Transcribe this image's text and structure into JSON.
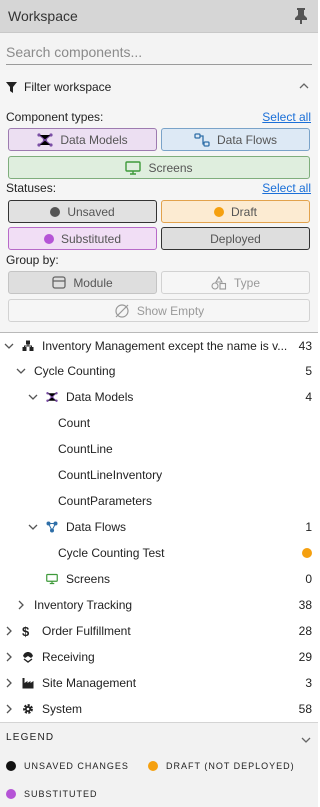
{
  "header": {
    "title": "Workspace"
  },
  "search": {
    "placeholder": "Search components..."
  },
  "filter": {
    "title": "Filter workspace",
    "component_types_label": "Component types:",
    "select_all_label": "Select all",
    "statuses_label": "Statuses:",
    "group_by_label": "Group by:",
    "component_types": [
      "Data Models",
      "Data Flows",
      "Screens"
    ],
    "statuses": [
      "Unsaved",
      "Draft",
      "Substituted",
      "Deployed"
    ],
    "group_by": [
      "Module",
      "Type"
    ],
    "show_empty": "Show Empty"
  },
  "tree": [
    {
      "label": "Inventory Management except the name is very long",
      "count": "43",
      "icon": "modules-icon"
    },
    {
      "label": "Cycle Counting",
      "count": "5"
    },
    {
      "label": "Data Models",
      "count": "4",
      "icon": "data-model-icon"
    },
    {
      "label": "Count"
    },
    {
      "label": "CountLine"
    },
    {
      "label": "CountLineInventory"
    },
    {
      "label": "CountParameters"
    },
    {
      "label": "Data Flows",
      "count": "1",
      "icon": "data-flow-icon"
    },
    {
      "label": "Cycle Counting Test",
      "status": "draft"
    },
    {
      "label": "Screens",
      "count": "0",
      "icon": "screen-icon"
    },
    {
      "label": "Inventory Tracking",
      "count": "38"
    },
    {
      "label": "Order Fulfillment",
      "count": "28",
      "icon": "dollar-icon"
    },
    {
      "label": "Receiving",
      "count": "29",
      "icon": "receiving-icon"
    },
    {
      "label": "Site Management",
      "count": "3",
      "icon": "factory-icon"
    },
    {
      "label": "System",
      "count": "58",
      "icon": "gear-icon"
    }
  ],
  "legend": {
    "title": "LEGEND",
    "items": [
      "UNSAVED CHANGES",
      "DRAFT (NOT DEPLOYED)",
      "SUBSTITUTED"
    ]
  },
  "colors": {
    "unsaved": "#111111",
    "draft": "#f5a00f",
    "substituted": "#b554d6",
    "data_model": "#7b4fa6",
    "data_flow": "#2f6fa8",
    "screen": "#3e9a3a",
    "link": "#1a6fd8"
  }
}
